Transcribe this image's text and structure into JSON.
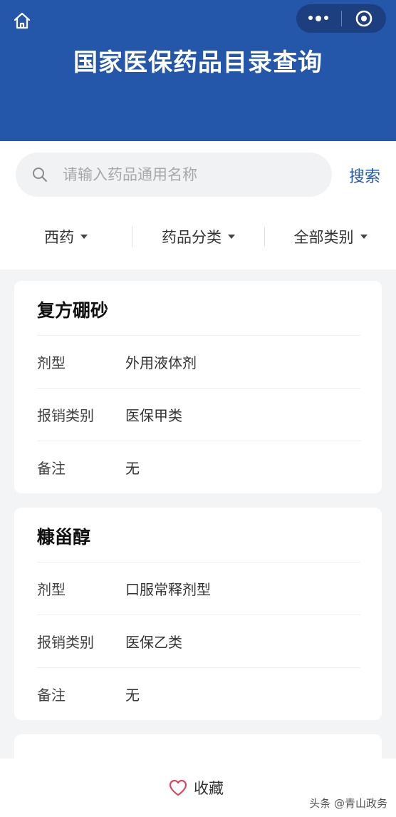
{
  "header": {
    "title": "国家医保药品目录查询",
    "home_icon": "home-icon",
    "menu_icon": "more-dots-icon",
    "close_icon": "mini-program-close-icon",
    "bg_color": "#2456a9"
  },
  "search": {
    "placeholder": "请输入药品通用名称",
    "value": "",
    "button_label": "搜索"
  },
  "filters": [
    {
      "label": "西药"
    },
    {
      "label": "药品分类"
    },
    {
      "label": "全部类别"
    }
  ],
  "drugs": [
    {
      "name": "复方硼砂",
      "rows": [
        {
          "key": "剂型",
          "value": "外用液体剂"
        },
        {
          "key": "报销类别",
          "value": "医保甲类"
        },
        {
          "key": "备注",
          "value": "无"
        }
      ]
    },
    {
      "name": "糠甾醇",
      "rows": [
        {
          "key": "剂型",
          "value": "口服常释剂型"
        },
        {
          "key": "报销类别",
          "value": "医保乙类"
        },
        {
          "key": "备注",
          "value": "无"
        }
      ]
    }
  ],
  "footer": {
    "favorite_label": "收藏",
    "watermark": "头条 @青山政务"
  }
}
